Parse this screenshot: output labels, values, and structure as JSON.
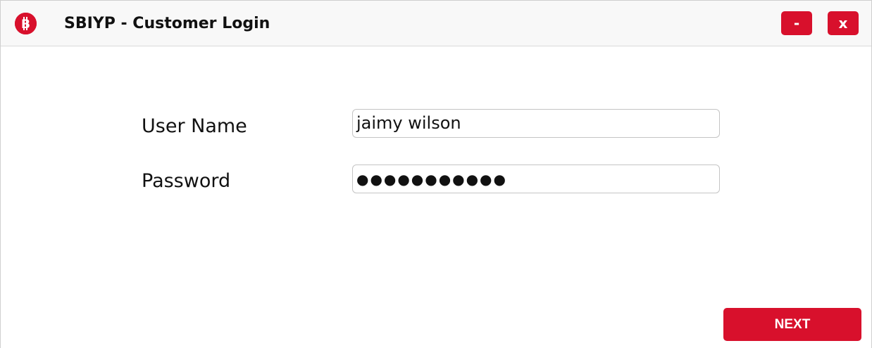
{
  "window": {
    "title": "SBIYP - Customer Login",
    "logo_icon": "bitcoin-icon",
    "logo_glyph": "B",
    "minimize_label": "-",
    "close_label": "x"
  },
  "form": {
    "username_label": "User Name",
    "username_value": "jaimy wilson",
    "password_label": "Password",
    "password_masked": "●●●●●●●●●●●"
  },
  "actions": {
    "next_label": "NEXT"
  },
  "colors": {
    "accent": "#d8102c",
    "titlebar_bg": "#f8f8f8",
    "text": "#111111",
    "field_border": "#c4c4c4"
  }
}
